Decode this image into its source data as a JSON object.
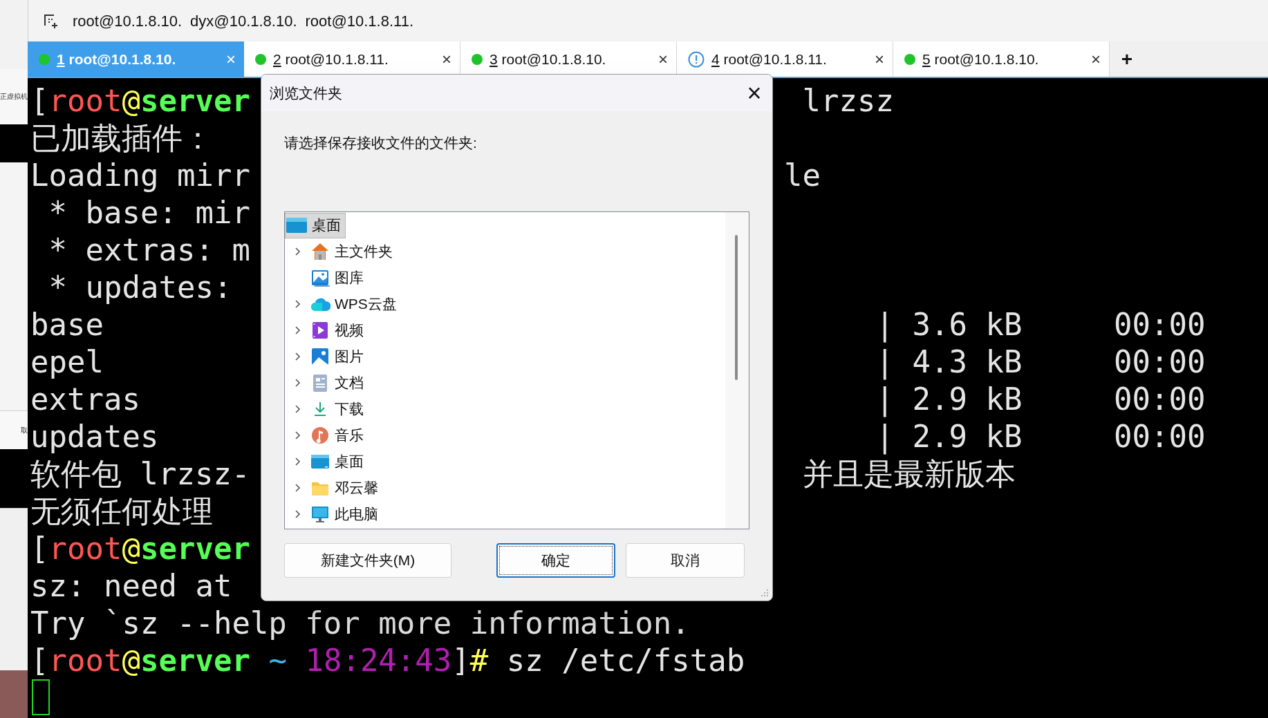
{
  "left_window_fragments": [
    "正虚拟机",
    "取"
  ],
  "top_bar": {
    "sessions": [
      "root@10.1.8.10.",
      "dyx@10.1.8.10.",
      "root@10.1.8.11."
    ]
  },
  "tabs": [
    {
      "number": "1",
      "label": "root@10.1.8.10.",
      "alert": false,
      "selected": true,
      "close": "×"
    },
    {
      "number": "2",
      "label": "root@10.1.8.11.",
      "alert": false,
      "selected": false,
      "close": "×"
    },
    {
      "number": "3",
      "label": "root@10.1.8.10.",
      "alert": false,
      "selected": false,
      "close": "×"
    },
    {
      "number": "4",
      "label": "root@10.1.8.11.",
      "alert": true,
      "selected": false,
      "close": "×"
    },
    {
      "number": "5",
      "label": "root@10.1.8.10.",
      "alert": false,
      "selected": false,
      "close": "×"
    }
  ],
  "new_tab": "+",
  "terminal": {
    "lines": [
      {
        "kind": "prompt",
        "segments": [
          {
            "text": "[",
            "color": "#e5e5e5"
          },
          {
            "text": "root",
            "color": "#ff5555"
          },
          {
            "text": "@",
            "color": "#ffff55"
          },
          {
            "text": "server",
            "color": "#55ff55"
          }
        ],
        "right": "lrzsz"
      },
      {
        "kind": "text",
        "text": "已加载插件："
      },
      {
        "kind": "text",
        "text": "Loading mirr",
        "right": "le"
      },
      {
        "kind": "text",
        "text": " * base: mir"
      },
      {
        "kind": "text",
        "text": " * extras: m"
      },
      {
        "kind": "text",
        "text": " * updates: "
      },
      {
        "kind": "text",
        "text": "base",
        "right": "| 3.6 kB     00:00"
      },
      {
        "kind": "text",
        "text": "epel",
        "right": "| 4.3 kB     00:00"
      },
      {
        "kind": "text",
        "text": "extras",
        "right": "| 2.9 kB     00:00"
      },
      {
        "kind": "text",
        "text": "updates",
        "right": "| 2.9 kB     00:00"
      },
      {
        "kind": "text",
        "text": "软件包 lrzsz-",
        "right": "并且是最新版本"
      },
      {
        "kind": "text",
        "text": "无须任何处理"
      },
      {
        "kind": "prompt",
        "segments": [
          {
            "text": "[",
            "color": "#e5e5e5"
          },
          {
            "text": "root",
            "color": "#ff5555"
          },
          {
            "text": "@",
            "color": "#ffff55"
          },
          {
            "text": "server",
            "color": "#55ff55"
          }
        ]
      },
      {
        "kind": "text",
        "text": "sz: need at"
      },
      {
        "kind": "text",
        "text": "Try `sz --help for more information."
      },
      {
        "kind": "prompt",
        "segments": [
          {
            "text": "[",
            "color": "#e5e5e5"
          },
          {
            "text": "root",
            "color": "#ff5555"
          },
          {
            "text": "@",
            "color": "#ffff55"
          },
          {
            "text": "server",
            "color": "#55ff55"
          },
          {
            "text": " ~ ",
            "color": "#3fb6e8"
          },
          {
            "text": "18:24:43",
            "color": "#b020b0"
          },
          {
            "text": "]",
            "color": "#e5e5e5"
          },
          {
            "text": "#",
            "color": "#ffff55"
          },
          {
            "text": " sz /etc/fstab",
            "color": "#e5e5e5"
          }
        ]
      },
      {
        "kind": "cursor"
      }
    ]
  },
  "dialog": {
    "title": "浏览文件夹",
    "close": "×",
    "prompt": "请选择保存接收文件的文件夹:",
    "tree": [
      {
        "label": "桌面",
        "selected": true,
        "children": [
          {
            "label": "主文件夹",
            "expandable": true,
            "selected": false
          },
          {
            "label": "图库",
            "expandable": false,
            "selected": false
          },
          {
            "label": "WPS云盘",
            "expandable": true,
            "selected": false
          },
          {
            "label": "视频",
            "expandable": true,
            "selected": false
          },
          {
            "label": "图片",
            "expandable": true,
            "selected": false
          },
          {
            "label": "文档",
            "expandable": true,
            "selected": false
          },
          {
            "label": "下载",
            "expandable": true,
            "selected": false
          },
          {
            "label": "音乐",
            "expandable": true,
            "selected": false
          },
          {
            "label": "桌面",
            "expandable": true,
            "selected": false
          },
          {
            "label": "邓云馨",
            "expandable": true,
            "selected": false
          },
          {
            "label": "此电脑",
            "expandable": true,
            "selected": false
          }
        ]
      }
    ],
    "buttons": [
      {
        "label": "新建文件夹(M)",
        "default": false
      },
      {
        "label": "确定",
        "default": true
      },
      {
        "label": "取消",
        "default": false
      }
    ]
  }
}
